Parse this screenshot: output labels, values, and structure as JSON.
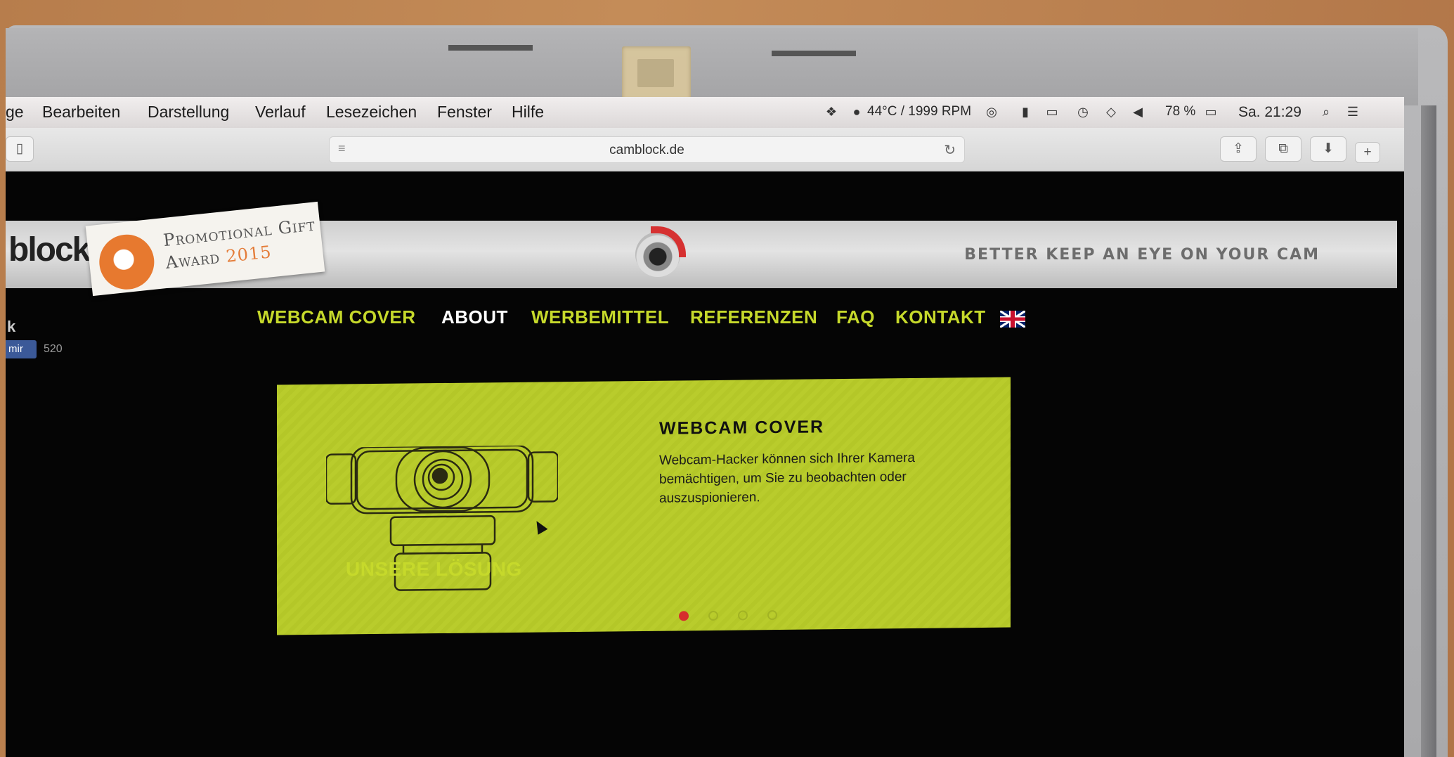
{
  "menubar": {
    "items": [
      "ge",
      "Bearbeiten",
      "Darstellung",
      "Verlauf",
      "Lesezeichen",
      "Fenster",
      "Hilfe"
    ],
    "temperature": "44°C / 1999 RPM",
    "battery": "78 %",
    "clock": "Sa. 21:29"
  },
  "browser": {
    "url": "camblock.de"
  },
  "header": {
    "award_line1": "Promotional Gift",
    "award_line2": "Award",
    "award_year": "2015",
    "tagline": "BETTER KEEP AN EYE ON YOUR CAM",
    "logo_text": "block"
  },
  "nav": {
    "items": [
      "WEBCAM COVER",
      "ABOUT",
      "WERBEMITTEL",
      "REFERENZEN",
      "FAQ",
      "KONTAKT"
    ],
    "active_index": 1
  },
  "sidebar": {
    "fragment": "k",
    "like_label": "mir",
    "like_count": "520"
  },
  "slider": {
    "title": "WEBCAM COVER",
    "text": "Webcam-Hacker können sich Ihrer Kamera bemächtigen, um Sie zu beobachten oder auszuspionieren.",
    "slides": 4,
    "active_slide": 1
  },
  "section": {
    "title": "UNSERE LÖSUNG"
  },
  "colors": {
    "accent": "#c6d92b",
    "slide_bg": "#b9cc2c",
    "active_dot": "#d62d2d"
  }
}
